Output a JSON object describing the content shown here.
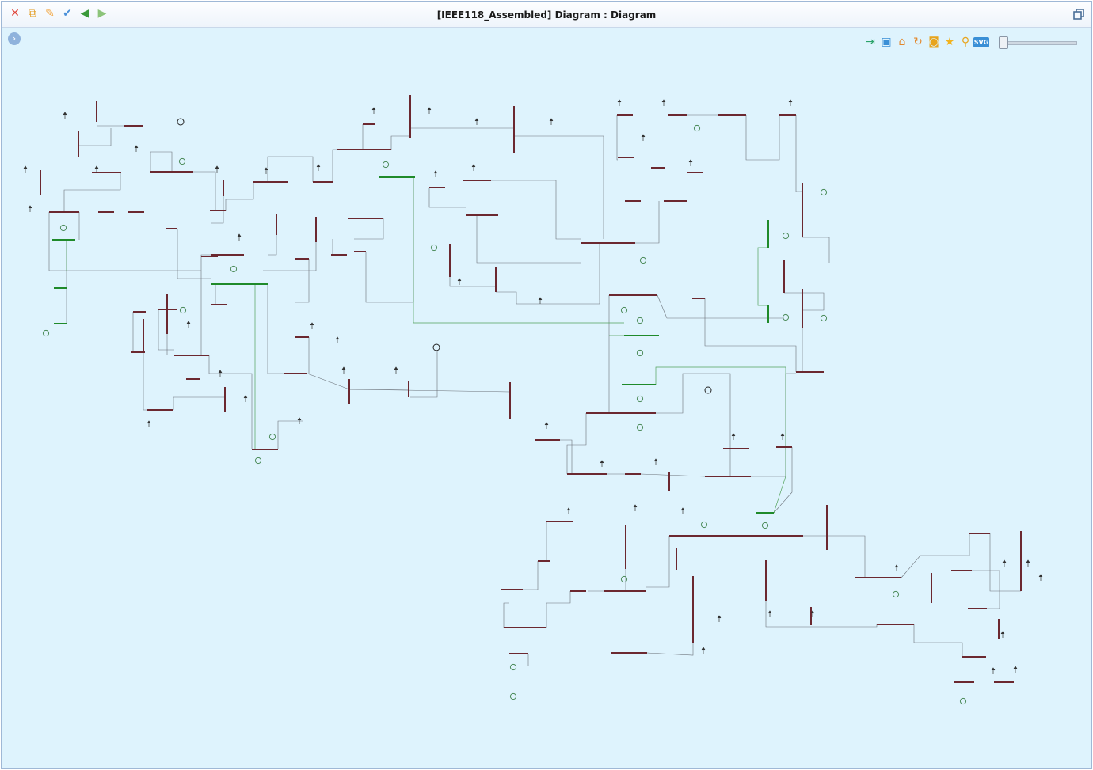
{
  "window": {
    "title": "[IEEE118_Assembled] Diagram : Diagram"
  },
  "toolbar": {
    "buttons": [
      {
        "name": "delete-button",
        "icon": "close-x-icon",
        "glyph": "✕",
        "color": "#e0463c"
      },
      {
        "name": "duplicate-button",
        "icon": "copy-icon",
        "glyph": "⧉",
        "color": "#e29a1c"
      },
      {
        "name": "pin-button",
        "icon": "pin-icon",
        "glyph": "✎",
        "color": "#f2a43c"
      },
      {
        "name": "validate-button",
        "icon": "check-icon",
        "glyph": "✔",
        "color": "#4a90d9"
      },
      {
        "name": "back-button",
        "icon": "arrow-left-icon",
        "glyph": "◀",
        "color": "#3a9a3a"
      },
      {
        "name": "forward-button",
        "icon": "arrow-right-icon",
        "glyph": "▶",
        "color": "#8cc47a"
      }
    ]
  },
  "diagram_toolbar": {
    "buttons": [
      {
        "name": "import-button",
        "icon": "import-icon",
        "glyph": "⇥",
        "color": "#2aa36a"
      },
      {
        "name": "export-button",
        "icon": "export-icon",
        "glyph": "▣",
        "color": "#3a8fd6"
      },
      {
        "name": "home-button",
        "icon": "home-icon",
        "glyph": "⌂",
        "color": "#e2872c"
      },
      {
        "name": "refresh-button",
        "icon": "refresh-icon",
        "glyph": "↻",
        "color": "#e2872c"
      },
      {
        "name": "fit-button",
        "icon": "frame-star-icon",
        "glyph": "◙",
        "color": "#e8a41c"
      },
      {
        "name": "favorite-button",
        "icon": "star-icon",
        "glyph": "★",
        "color": "#f2b21c"
      },
      {
        "name": "search-button",
        "icon": "search-icon",
        "glyph": "⚲",
        "color": "#e8a41c"
      }
    ],
    "svg_label": "SVG"
  }
}
